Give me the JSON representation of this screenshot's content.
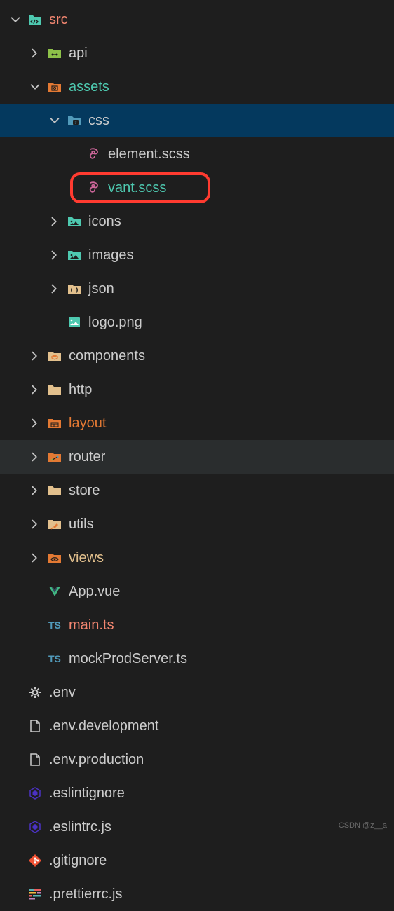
{
  "tree": {
    "src": "src",
    "api": "api",
    "assets": "assets",
    "css": "css",
    "element_scss": "element.scss",
    "vant_scss": "vant.scss",
    "icons": "icons",
    "images": "images",
    "json": "json",
    "logo_png": "logo.png",
    "components": "components",
    "http": "http",
    "layout": "layout",
    "router": "router",
    "store": "store",
    "utils": "utils",
    "views": "views",
    "app_vue": "App.vue",
    "main_ts": "main.ts",
    "mockprod_ts": "mockProdServer.ts",
    "env": ".env",
    "env_dev": ".env.development",
    "env_prod": ".env.production",
    "eslintignore": ".eslintignore",
    "eslintrc": ".eslintrc.js",
    "gitignore": ".gitignore",
    "prettierrc": ".prettierrc.js"
  },
  "watermark": "CSDN @z__a"
}
